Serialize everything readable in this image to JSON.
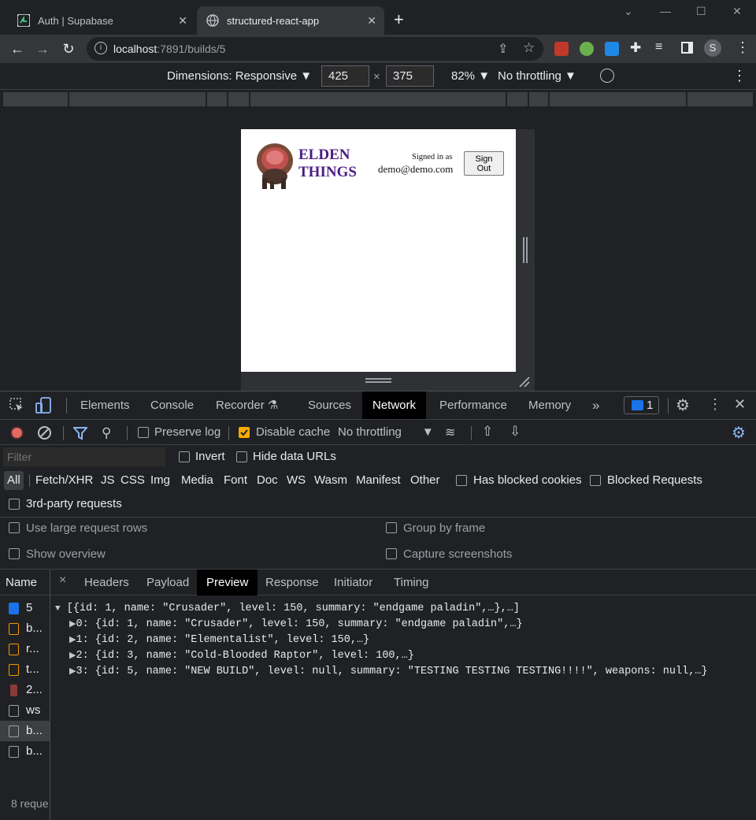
{
  "browser": {
    "tabs": [
      {
        "title": "Auth | Supabase",
        "active": false
      },
      {
        "title": "structured-react-app",
        "active": true
      }
    ],
    "new_tab": "+",
    "url_host": "localhost",
    "url_rest": ":7891/builds/5",
    "profile_initial": "S"
  },
  "device_toolbar": {
    "dimensions_label": "Dimensions: Responsive",
    "width": "425",
    "height": "375",
    "times": "×",
    "zoom": "82%",
    "throttling": "No throttling"
  },
  "app": {
    "logo_line1": "ELDEN",
    "logo_line2": "THINGS",
    "signed_in_label": "Signed in as",
    "user_email": "demo@demo.com",
    "sign_out_line1": "Sign",
    "sign_out_line2": "Out"
  },
  "devtools": {
    "tabs": [
      "Elements",
      "Console",
      "Recorder",
      "Sources",
      "Network",
      "Performance",
      "Memory"
    ],
    "active_tab": "Network",
    "more": "»",
    "issues_count": "1",
    "network": {
      "preserve_log": "Preserve log",
      "disable_cache": "Disable cache",
      "throttling": "No throttling",
      "filter_placeholder": "Filter",
      "invert": "Invert",
      "hide_data_urls": "Hide data URLs",
      "types": [
        "All",
        "Fetch/XHR",
        "JS",
        "CSS",
        "Img",
        "Media",
        "Font",
        "Doc",
        "WS",
        "Wasm",
        "Manifest",
        "Other"
      ],
      "has_blocked_cookies": "Has blocked cookies",
      "blocked_requests": "Blocked Requests",
      "third_party": "3rd-party requests",
      "use_large_rows": "Use large request rows",
      "group_by_frame": "Group by frame",
      "show_overview": "Show overview",
      "capture_screenshots": "Capture screenshots"
    },
    "requests": {
      "header": "Name",
      "rows": [
        "5",
        "b...",
        "r...",
        "t...",
        "2...",
        "ws",
        "b...",
        "b..."
      ],
      "footer": "8 reque"
    },
    "detail_tabs": [
      "Headers",
      "Payload",
      "Preview",
      "Response",
      "Initiator",
      "Timing"
    ],
    "active_detail_tab": "Preview",
    "close": "×",
    "preview_lines": [
      "[{id: 1, name: \"Crusader\", level: 150, summary: \"endgame paladin\",…},…]",
      "0: {id: 1, name: \"Crusader\", level: 150, summary: \"endgame paladin\",…}",
      "1: {id: 2, name: \"Elementalist\", level: 150,…}",
      "2: {id: 3, name: \"Cold-Blooded Raptor\", level: 100,…}",
      "3: {id: 5, name: \"NEW BUILD\", level: null, summary: \"TESTING TESTING TESTING!!!!\", weapons: null,…}"
    ]
  }
}
